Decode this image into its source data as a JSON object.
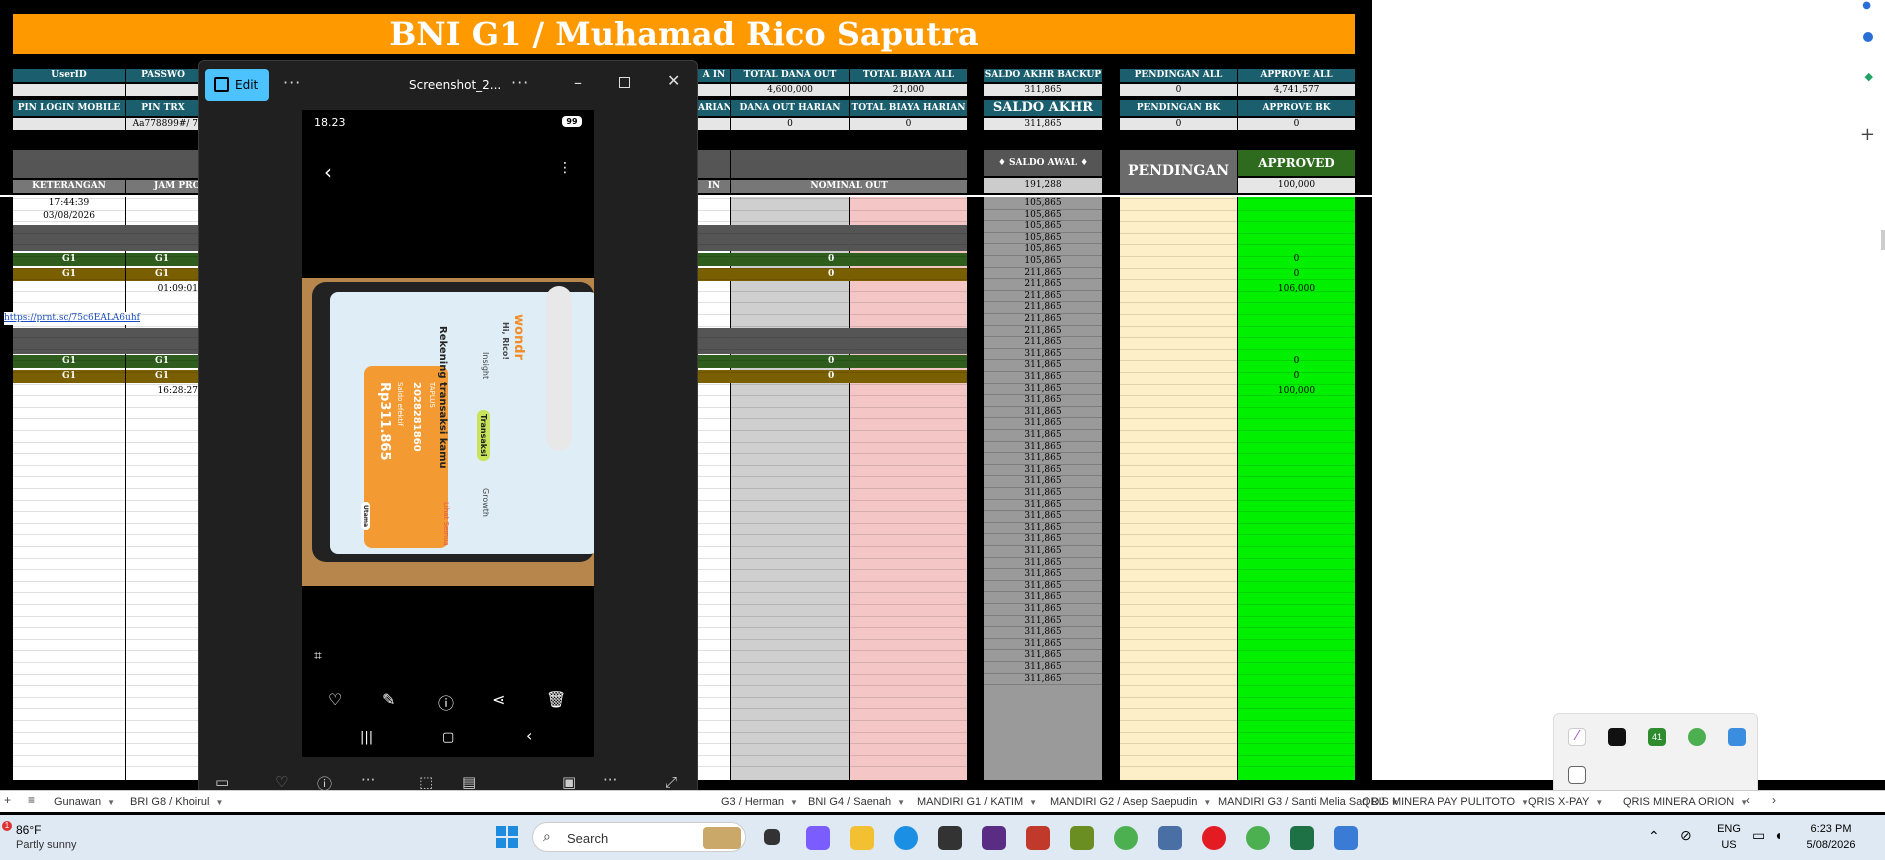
{
  "sheet": {
    "banner_title": "BNI G1 / Muhamad Rico Saputra",
    "headers": {
      "userid": "UserID",
      "password": "PASSWO",
      "pin_login_mobile": "PIN LOGIN MOBILE",
      "pin_trx": "PIN TRX",
      "pin_trx_value": "Aa778899#/ 7",
      "in_partial": "A IN",
      "arian_partial": "ARIAN",
      "total_dana_out": "TOTAL DANA OUT",
      "total_biaya_all": "TOTAL BIAYA ALL",
      "dana_out_harian": "DANA OUT HARIAN",
      "total_biaya_harian": "TOTAL BIAYA HARIAN",
      "saldo_akhr_backup": "SALDO AKHR BACKUP",
      "saldo_akhr": "SALDO AKHR",
      "pendingan_all": "PENDINGAN ALL",
      "approve_all": "APPROVE ALL",
      "pendingan_bk": "PENDINGAN BK",
      "approve_bk": "APPROVE BK",
      "saldo_awal": "♦ SALDO AWAL ♦",
      "pendingan": "PENDINGAN",
      "approved": "APPROVED",
      "keterangan": "KETERANGAN",
      "jam_pros": "JAM PROS",
      "in_partial2": "IN",
      "nominal_out": "NOMINAL OUT"
    },
    "values": {
      "total_dana_out": "4,600,000",
      "total_biaya_all": "21,000",
      "dana_out_harian": "0",
      "total_biaya_harian": "0",
      "saldo_akhr_backup": "311,865",
      "saldo_akhr": "311,865",
      "pendingan_all": "0",
      "approve_all": "4,741,577",
      "pendingan_bk": "0",
      "approve_bk": "0",
      "saldo_awal": "191,288",
      "approved_top": "100,000"
    },
    "rows": {
      "time1": "17:44:39",
      "date1": "03/08/2026",
      "g1": "G1",
      "zero": "0",
      "time2": "01:09:01",
      "link": "https://prnt.sc/75c6EALA6uhf",
      "time3": "16:28:27",
      "approved_106": "106,000",
      "approved_100": "100,000"
    },
    "saldo_column": [
      "105,865",
      "105,865",
      "105,865",
      "105,865",
      "105,865",
      "105,865",
      "211,865",
      "211,865",
      "211,865",
      "211,865",
      "211,865",
      "211,865",
      "211,865",
      "311,865",
      "311,865",
      "311,865",
      "311,865",
      "311,865",
      "311,865",
      "311,865",
      "311,865",
      "311,865",
      "311,865",
      "311,865",
      "311,865",
      "311,865",
      "311,865",
      "311,865",
      "311,865",
      "311,865",
      "311,865",
      "311,865",
      "311,865",
      "311,865",
      "311,865",
      "311,865",
      "311,865",
      "311,865",
      "311,865",
      "311,865",
      "311,865",
      "311,865"
    ]
  },
  "viewer": {
    "edit_label": "Edit",
    "file_title": "Screenshot_2...",
    "more": "···",
    "phone_time": "18.23",
    "phone_battery": "99",
    "app_greeting": "Hi, Rico!",
    "app_heading": "Rekening transaksi kamu",
    "app_account": "2028281860",
    "app_tag": "TAPLUS",
    "app_saldo_label": "Saldo efektif",
    "app_balance": "Rp311.865",
    "app_tab_insight": "Insight",
    "app_tab_transaksi": "Transaksi",
    "app_tab_growth": "Growth",
    "app_lihat_semua": "Lihat Semua",
    "app_utama": "Utama",
    "app_logo": "wondr"
  },
  "tabs": [
    {
      "label": "Gunawan"
    },
    {
      "label": "BRI G8 / Khoirul"
    },
    {
      "label": "G3 / Herman"
    },
    {
      "label": "BNI G4 / Saenah"
    },
    {
      "label": "MANDIRI G1 / KATIM"
    },
    {
      "label": "MANDIRI G2 / Asep Saepudin"
    },
    {
      "label": "MANDIRI G3 / Santi Melia Sari DJ"
    },
    {
      "label": "QRIS MINERA PAY PULITOTO"
    },
    {
      "label": "QRIS X-PAY"
    },
    {
      "label": "QRIS MINERA ORION"
    }
  ],
  "taskbar": {
    "weather_temp": "86°F",
    "weather_desc": "Partly sunny",
    "weather_badge": "1",
    "search_placeholder": "Search",
    "lang1": "ENG",
    "lang2": "US",
    "time": "6:23 PM",
    "date": "5/08/2026",
    "tray_badge": "41"
  }
}
